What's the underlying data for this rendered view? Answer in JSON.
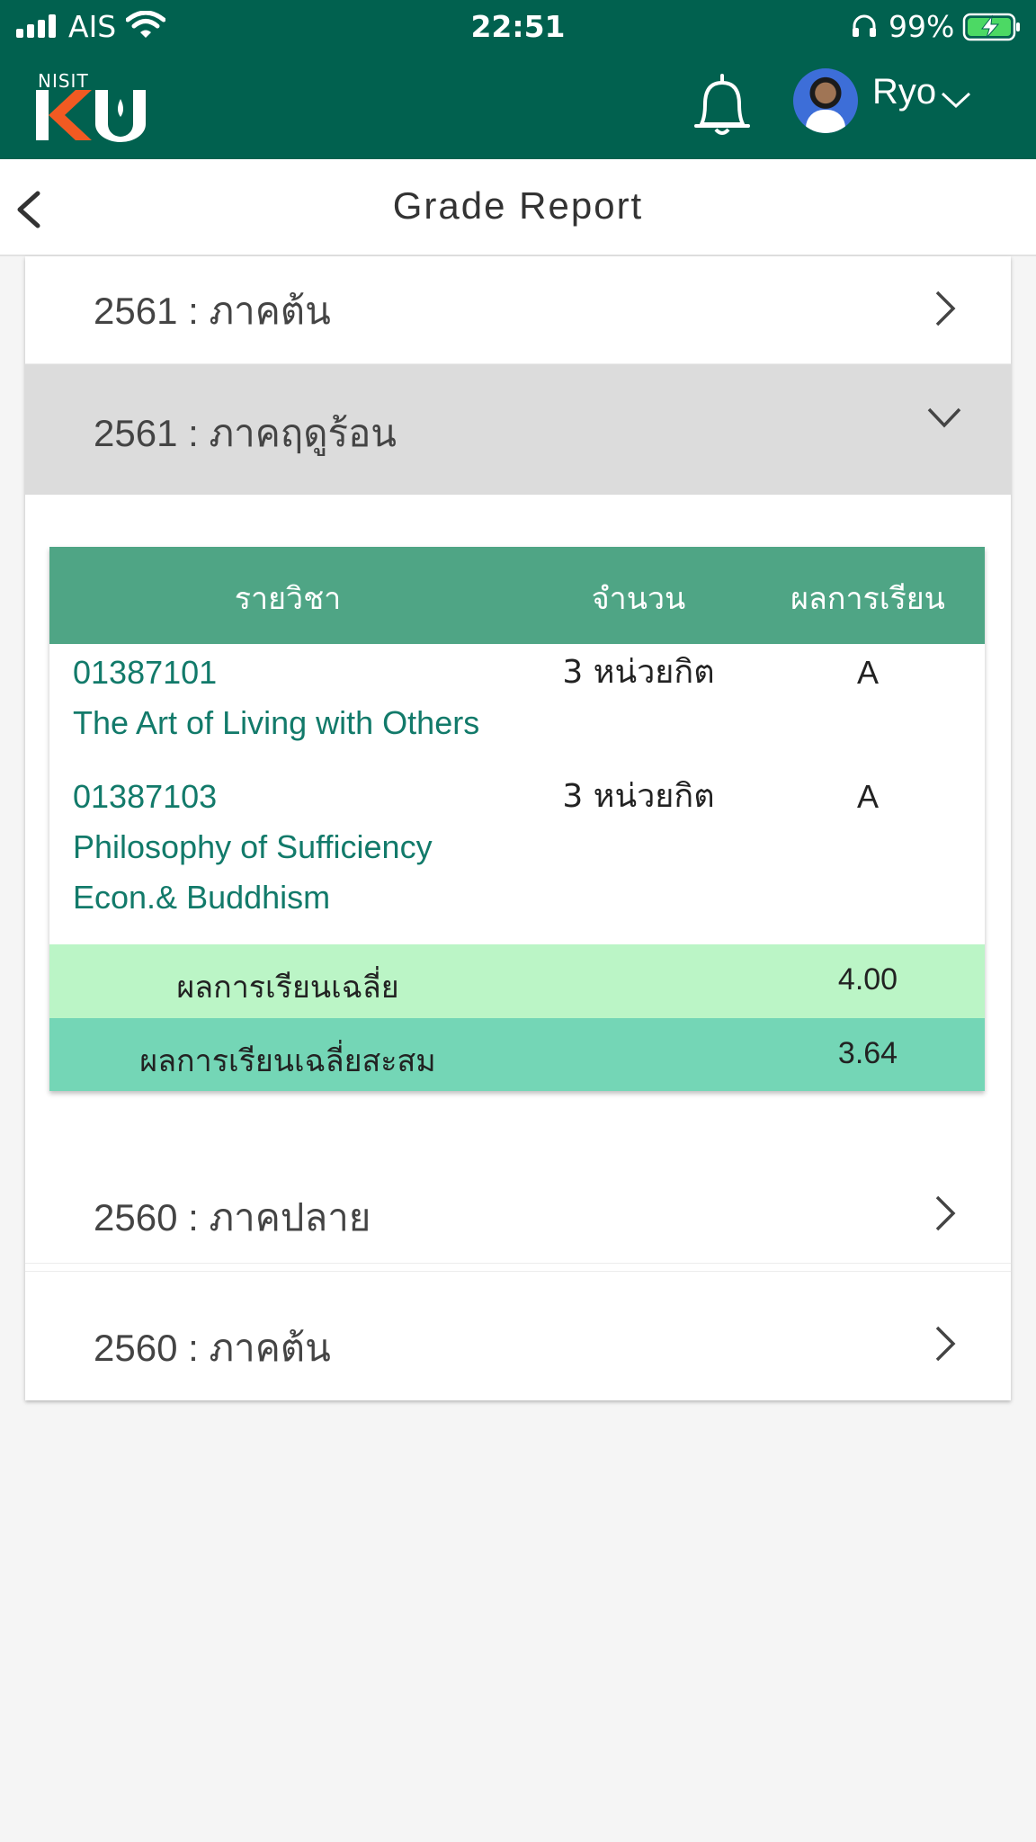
{
  "status_bar": {
    "carrier": "AIS",
    "time": "22:51",
    "battery": "99%"
  },
  "app_bar": {
    "logo_small": "NISIT",
    "logo_main": "KU",
    "username": "Ryo",
    "colors": {
      "bar": "#01614f"
    }
  },
  "page": {
    "title": "Grade Report"
  },
  "semesters": [
    {
      "label": "2561 : ภาคต้น",
      "expanded": false
    },
    {
      "label": "2561 : ภาคฤดูร้อน",
      "expanded": true
    },
    {
      "label": "2560 : ภาคปลาย",
      "expanded": false
    },
    {
      "label": "2560 : ภาคต้น",
      "expanded": false
    }
  ],
  "grade_table": {
    "headers": {
      "course": "รายวิชา",
      "credits": "จำนวน",
      "grade": "ผลการเรียน"
    },
    "courses": [
      {
        "code": "01387101",
        "name": "The Art of Living with Others",
        "credits": "3 หน่วยกิต",
        "grade": "A"
      },
      {
        "code": "01387103",
        "name_line1": "Philosophy of Sufficiency",
        "name_line2": "Econ.& Buddhism",
        "credits": "3 หน่วยกิต",
        "grade": "A"
      }
    ],
    "gpa": {
      "label": "ผลการเรียนเฉลี่ย",
      "value": "4.00"
    },
    "cumulative_gpa": {
      "label": "ผลการเรียนเฉลี่ยสะสม",
      "value": "3.64"
    },
    "colors": {
      "header": "#4fa585",
      "gpa_row": "#bbf5c6",
      "cum_row": "#74d6b6"
    }
  }
}
